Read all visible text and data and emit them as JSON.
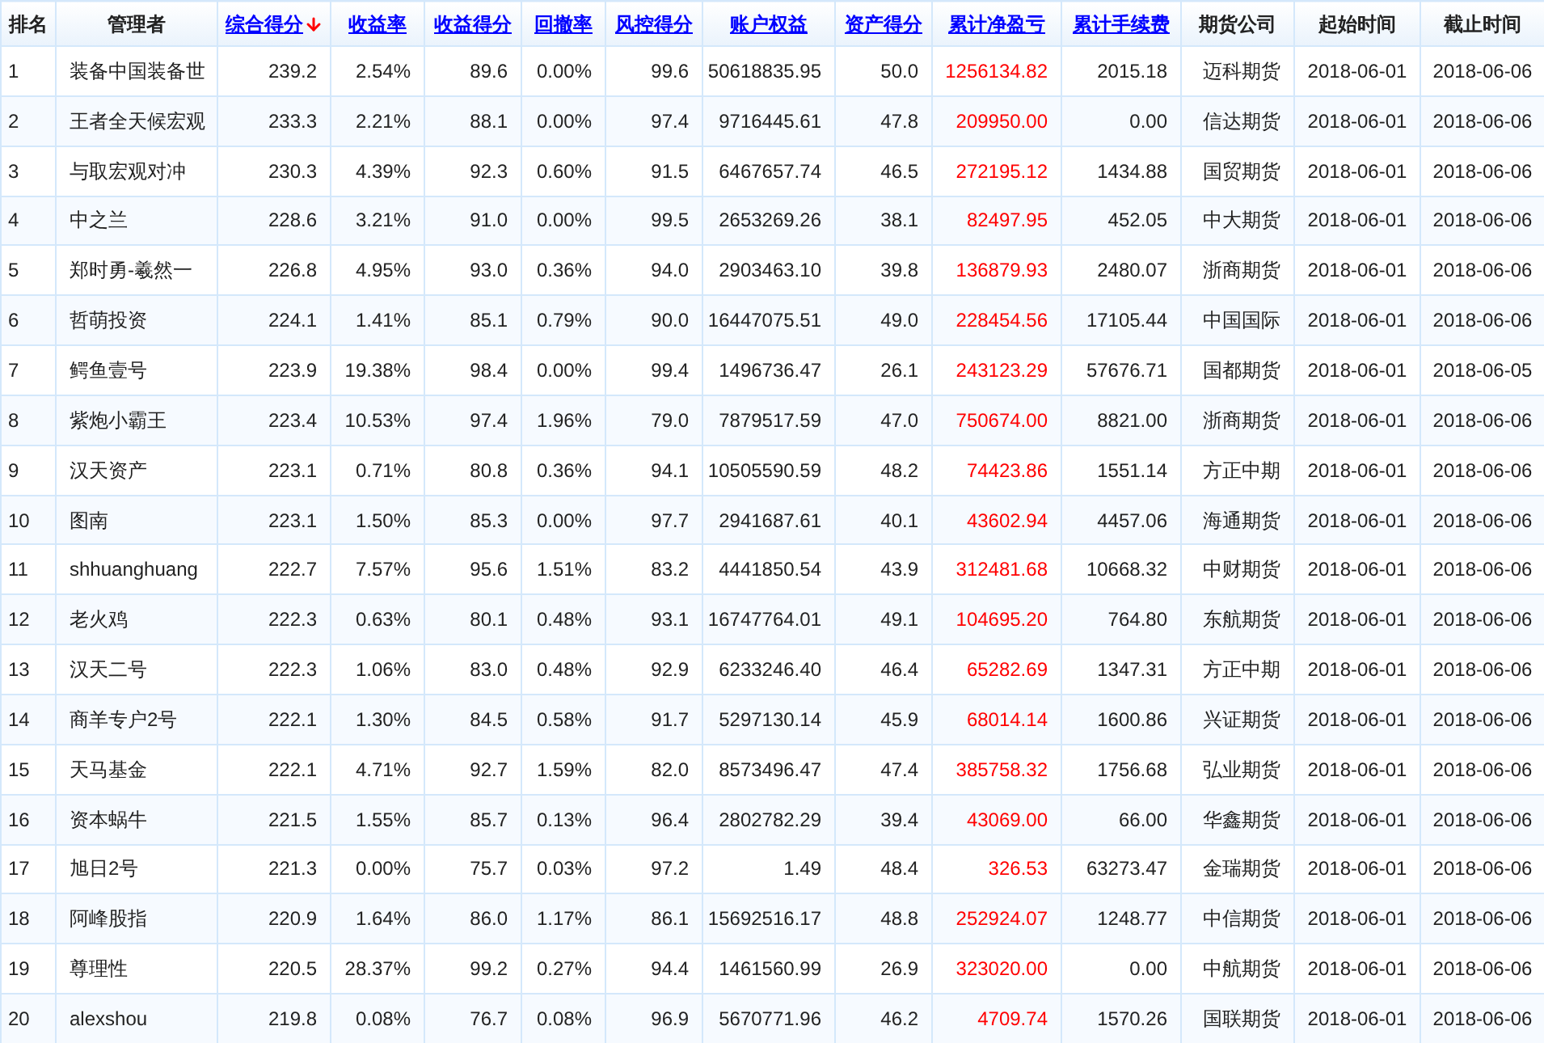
{
  "table": {
    "columns": [
      {
        "label": "排名",
        "kind": "rank",
        "link": false,
        "sorted": false
      },
      {
        "label": "管理者",
        "kind": "text",
        "link": false,
        "sorted": false
      },
      {
        "label": "综合得分",
        "kind": "number",
        "link": true,
        "sorted": true
      },
      {
        "label": "收益率",
        "kind": "number",
        "link": true,
        "sorted": false
      },
      {
        "label": "收益得分",
        "kind": "number",
        "link": true,
        "sorted": false
      },
      {
        "label": "回撤率",
        "kind": "number",
        "link": true,
        "sorted": false
      },
      {
        "label": "风控得分",
        "kind": "number",
        "link": true,
        "sorted": false
      },
      {
        "label": "账户权益",
        "kind": "number",
        "link": true,
        "sorted": false
      },
      {
        "label": "资产得分",
        "kind": "number",
        "link": true,
        "sorted": false
      },
      {
        "label": "累计净盈亏",
        "kind": "profit",
        "link": true,
        "sorted": false
      },
      {
        "label": "累计手续费",
        "kind": "number",
        "link": true,
        "sorted": false
      },
      {
        "label": "期货公司",
        "kind": "number",
        "link": false,
        "sorted": false
      },
      {
        "label": "起始时间",
        "kind": "date",
        "link": false,
        "sorted": false
      },
      {
        "label": "截止时间",
        "kind": "date",
        "link": false,
        "sorted": false
      }
    ],
    "rows": [
      [
        "1",
        "装备中国装备世",
        "239.2",
        "2.54%",
        "89.6",
        "0.00%",
        "99.6",
        "50618835.95",
        "50.0",
        "1256134.82",
        "2015.18",
        "迈科期货",
        "2018-06-01",
        "2018-06-06"
      ],
      [
        "2",
        "王者全天候宏观",
        "233.3",
        "2.21%",
        "88.1",
        "0.00%",
        "97.4",
        "9716445.61",
        "47.8",
        "209950.00",
        "0.00",
        "信达期货",
        "2018-06-01",
        "2018-06-06"
      ],
      [
        "3",
        "与取宏观对冲",
        "230.3",
        "4.39%",
        "92.3",
        "0.60%",
        "91.5",
        "6467657.74",
        "46.5",
        "272195.12",
        "1434.88",
        "国贸期货",
        "2018-06-01",
        "2018-06-06"
      ],
      [
        "4",
        "中之兰",
        "228.6",
        "3.21%",
        "91.0",
        "0.00%",
        "99.5",
        "2653269.26",
        "38.1",
        "82497.95",
        "452.05",
        "中大期货",
        "2018-06-01",
        "2018-06-06"
      ],
      [
        "5",
        "郑时勇-羲然一",
        "226.8",
        "4.95%",
        "93.0",
        "0.36%",
        "94.0",
        "2903463.10",
        "39.8",
        "136879.93",
        "2480.07",
        "浙商期货",
        "2018-06-01",
        "2018-06-06"
      ],
      [
        "6",
        "哲萌投资",
        "224.1",
        "1.41%",
        "85.1",
        "0.79%",
        "90.0",
        "16447075.51",
        "49.0",
        "228454.56",
        "17105.44",
        "中国国际",
        "2018-06-01",
        "2018-06-06"
      ],
      [
        "7",
        "鳄鱼壹号",
        "223.9",
        "19.38%",
        "98.4",
        "0.00%",
        "99.4",
        "1496736.47",
        "26.1",
        "243123.29",
        "57676.71",
        "国都期货",
        "2018-06-01",
        "2018-06-05"
      ],
      [
        "8",
        "紫炮小霸王",
        "223.4",
        "10.53%",
        "97.4",
        "1.96%",
        "79.0",
        "7879517.59",
        "47.0",
        "750674.00",
        "8821.00",
        "浙商期货",
        "2018-06-01",
        "2018-06-06"
      ],
      [
        "9",
        "汉天资产",
        "223.1",
        "0.71%",
        "80.8",
        "0.36%",
        "94.1",
        "10505590.59",
        "48.2",
        "74423.86",
        "1551.14",
        "方正中期",
        "2018-06-01",
        "2018-06-06"
      ],
      [
        "10",
        "图南",
        "223.1",
        "1.50%",
        "85.3",
        "0.00%",
        "97.7",
        "2941687.61",
        "40.1",
        "43602.94",
        "4457.06",
        "海通期货",
        "2018-06-01",
        "2018-06-06"
      ],
      [
        "11",
        "shhuanghuang",
        "222.7",
        "7.57%",
        "95.6",
        "1.51%",
        "83.2",
        "4441850.54",
        "43.9",
        "312481.68",
        "10668.32",
        "中财期货",
        "2018-06-01",
        "2018-06-06"
      ],
      [
        "12",
        "老火鸡",
        "222.3",
        "0.63%",
        "80.1",
        "0.48%",
        "93.1",
        "16747764.01",
        "49.1",
        "104695.20",
        "764.80",
        "东航期货",
        "2018-06-01",
        "2018-06-06"
      ],
      [
        "13",
        "汉天二号",
        "222.3",
        "1.06%",
        "83.0",
        "0.48%",
        "92.9",
        "6233246.40",
        "46.4",
        "65282.69",
        "1347.31",
        "方正中期",
        "2018-06-01",
        "2018-06-06"
      ],
      [
        "14",
        "商羊专户2号",
        "222.1",
        "1.30%",
        "84.5",
        "0.58%",
        "91.7",
        "5297130.14",
        "45.9",
        "68014.14",
        "1600.86",
        "兴证期货",
        "2018-06-01",
        "2018-06-06"
      ],
      [
        "15",
        "天马基金",
        "222.1",
        "4.71%",
        "92.7",
        "1.59%",
        "82.0",
        "8573496.47",
        "47.4",
        "385758.32",
        "1756.68",
        "弘业期货",
        "2018-06-01",
        "2018-06-06"
      ],
      [
        "16",
        "资本蜗牛",
        "221.5",
        "1.55%",
        "85.7",
        "0.13%",
        "96.4",
        "2802782.29",
        "39.4",
        "43069.00",
        "66.00",
        "华鑫期货",
        "2018-06-01",
        "2018-06-06"
      ],
      [
        "17",
        "旭日2号",
        "221.3",
        "0.00%",
        "75.7",
        "0.03%",
        "97.2",
        "1.49",
        "48.4",
        "326.53",
        "63273.47",
        "金瑞期货",
        "2018-06-01",
        "2018-06-06"
      ],
      [
        "18",
        "阿峰股指",
        "220.9",
        "1.64%",
        "86.0",
        "1.17%",
        "86.1",
        "15692516.17",
        "48.8",
        "252924.07",
        "1248.77",
        "中信期货",
        "2018-06-01",
        "2018-06-06"
      ],
      [
        "19",
        "尊理性",
        "220.5",
        "28.37%",
        "99.2",
        "0.27%",
        "94.4",
        "1461560.99",
        "26.9",
        "323020.00",
        "0.00",
        "中航期货",
        "2018-06-01",
        "2018-06-06"
      ],
      [
        "20",
        "alexshou",
        "219.8",
        "0.08%",
        "76.7",
        "0.08%",
        "96.9",
        "5670771.96",
        "46.2",
        "4709.74",
        "1570.26",
        "国联期货",
        "2018-06-01",
        "2018-06-06"
      ]
    ]
  }
}
